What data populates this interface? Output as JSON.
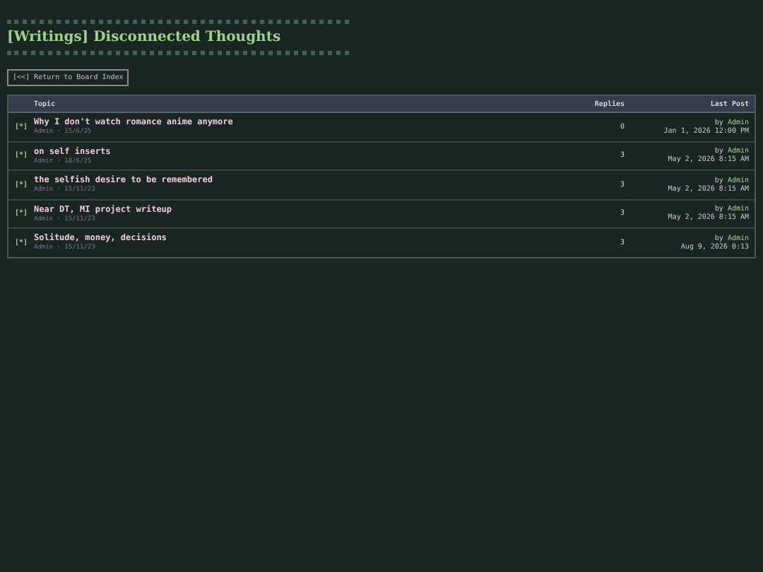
{
  "title": "[Writings] Disconnected Thoughts",
  "back_link": "[<<] Return to Board Index",
  "table": {
    "columns": [
      "Topic",
      "Replies",
      "Last Post"
    ],
    "rows": [
      {
        "icon": "[*]",
        "topic": "Why I don't watch romance anime anymore",
        "byline": "Admin · 15/6/25",
        "replies": "0",
        "last_by": "by",
        "last_author": "Admin",
        "last_time": "Jan 1, 2026 12:00 PM"
      },
      {
        "icon": "[*]",
        "topic": "on self inserts",
        "byline": "Admin · 18/6/25",
        "replies": "3",
        "last_by": "by",
        "last_author": "Admin",
        "last_time": "May 2, 2026 8:15 AM"
      },
      {
        "icon": "[*]",
        "topic": "the selfish desire to be remembered",
        "byline": "Admin · 15/11/23",
        "replies": "3",
        "last_by": "by",
        "last_author": "Admin",
        "last_time": "May 2, 2026 8:15 AM"
      },
      {
        "icon": "[*]",
        "topic": "Near DT, MI project writeup",
        "byline": "Admin · 15/11/23",
        "replies": "3",
        "last_by": "by",
        "last_author": "Admin",
        "last_time": "May 2, 2026 8:15 AM"
      },
      {
        "icon": "[*]",
        "topic": "Solitude, money, decisions",
        "byline": "Admin · 15/11/23",
        "replies": "3",
        "last_by": "by",
        "last_author": "Admin",
        "last_time": "Aug 9, 2026 0:13"
      }
    ]
  }
}
